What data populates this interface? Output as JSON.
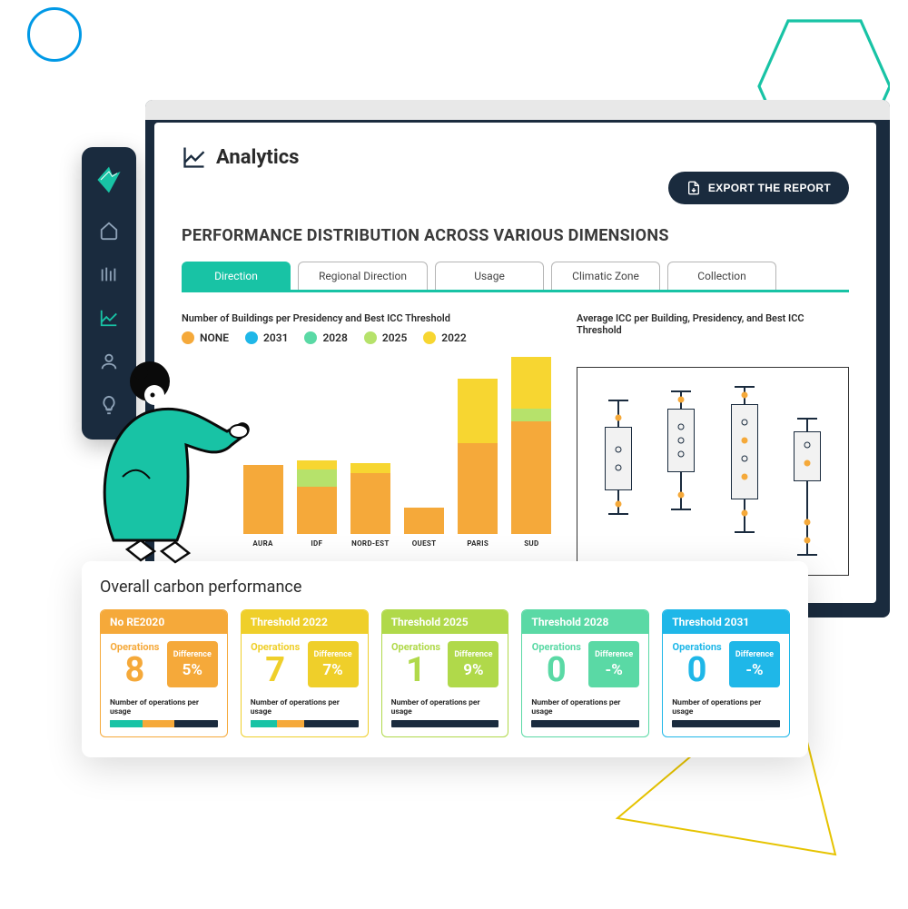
{
  "colors": {
    "teal": "#18c3a5",
    "dark": "#1a2b3e",
    "orange": "#f5a93a",
    "cyan": "#1fb7e8",
    "mint": "#5ad9a5",
    "lime": "#b6e26b",
    "yellow": "#f7d631"
  },
  "page": {
    "title": "Analytics",
    "export_label": "EXPORT THE REPORT",
    "section_title": "PERFORMANCE DISTRIBUTION ACROSS VARIOUS DIMENSIONS"
  },
  "tabs": [
    {
      "label": "Direction",
      "active": true
    },
    {
      "label": "Regional Direction",
      "active": false
    },
    {
      "label": "Usage",
      "active": false
    },
    {
      "label": "Climatic Zone",
      "active": false
    },
    {
      "label": "Collection",
      "active": false
    }
  ],
  "left_caption": "Number of Buildings per Presidency and Best ICC Threshold",
  "right_caption": "Average ICC per Building, Presidency, and Best ICC Threshold",
  "legend": [
    {
      "label": "NONE",
      "color": "#f5a93a"
    },
    {
      "label": "2031",
      "color": "#1fb7e8"
    },
    {
      "label": "2028",
      "color": "#5ad9a5"
    },
    {
      "label": "2025",
      "color": "#b6e26b"
    },
    {
      "label": "2022",
      "color": "#f7d631"
    }
  ],
  "chart_data": {
    "type": "bar",
    "title": "Number of Buildings per Presidency and Best ICC Threshold",
    "xlabel": "",
    "ylabel": "",
    "categories": [
      "AURA",
      "IDF",
      "NORD-EST",
      "OUEST",
      "PARIS",
      "SUD"
    ],
    "series": [
      {
        "name": "NONE",
        "color": "#f5a93a",
        "values": [
          80,
          55,
          70,
          30,
          105,
          130
        ]
      },
      {
        "name": "2025",
        "color": "#b6e26b",
        "values": [
          0,
          20,
          0,
          0,
          0,
          15
        ]
      },
      {
        "name": "2022",
        "color": "#f7d631",
        "values": [
          0,
          10,
          12,
          0,
          75,
          60
        ]
      }
    ],
    "ylim": [
      0,
      210
    ]
  },
  "boxplot": {
    "type": "boxplot",
    "title": "Average ICC per Building, Presidency, and Best ICC Threshold",
    "columns": [
      {
        "cap_top": 25,
        "cap_bot": 150,
        "box_top": 55,
        "box_bot": 125,
        "dots": [
          {
            "y": 45,
            "t": "fill"
          },
          {
            "y": 80,
            "t": "open"
          },
          {
            "y": 100,
            "t": "open"
          },
          {
            "y": 140,
            "t": "fill"
          }
        ]
      },
      {
        "cap_top": 15,
        "cap_bot": 145,
        "box_top": 35,
        "box_bot": 105,
        "dots": [
          {
            "y": 25,
            "t": "fill"
          },
          {
            "y": 55,
            "t": "open"
          },
          {
            "y": 70,
            "t": "open"
          },
          {
            "y": 85,
            "t": "open"
          },
          {
            "y": 130,
            "t": "fill"
          }
        ]
      },
      {
        "cap_top": 10,
        "cap_bot": 170,
        "box_top": 30,
        "box_bot": 135,
        "dots": [
          {
            "y": 20,
            "t": "fill"
          },
          {
            "y": 50,
            "t": "open"
          },
          {
            "y": 70,
            "t": "fill"
          },
          {
            "y": 90,
            "t": "open"
          },
          {
            "y": 110,
            "t": "fill"
          },
          {
            "y": 150,
            "t": "fill"
          }
        ]
      },
      {
        "cap_top": 45,
        "cap_bot": 195,
        "box_top": 60,
        "box_bot": 115,
        "dots": [
          {
            "y": 75,
            "t": "open"
          },
          {
            "y": 95,
            "t": "fill"
          },
          {
            "y": 160,
            "t": "fill"
          },
          {
            "y": 180,
            "t": "fill"
          }
        ]
      }
    ]
  },
  "carbon": {
    "title": "Overall carbon performance",
    "footer": "Number of operations per usage",
    "ops_label": "Operations",
    "diff_label": "Difference",
    "cards": [
      {
        "title": "No RE2020",
        "color": "#f5a93a",
        "ops": "8",
        "diff": "5%",
        "bar": [
          30,
          30
        ]
      },
      {
        "title": "Threshold 2022",
        "color": "#efcf2a",
        "ops": "7",
        "diff": "7%",
        "bar": [
          25,
          25
        ]
      },
      {
        "title": "Threshold 2025",
        "color": "#b0d94a",
        "ops": "1",
        "diff": "9%",
        "bar": [
          0,
          0
        ]
      },
      {
        "title": "Threshold 2028",
        "color": "#5ad9a5",
        "ops": "0",
        "diff": "-%",
        "bar": [
          0,
          0
        ]
      },
      {
        "title": "Threshold 2031",
        "color": "#1fb7e8",
        "ops": "0",
        "diff": "-%",
        "bar": [
          0,
          0
        ]
      }
    ]
  }
}
